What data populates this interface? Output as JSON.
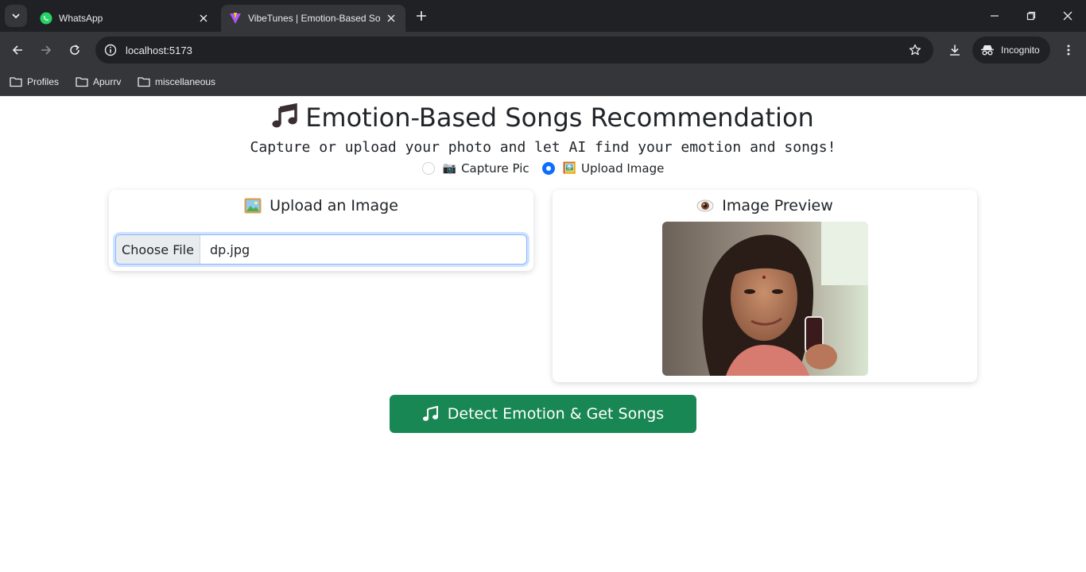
{
  "browser": {
    "tabs": [
      {
        "title": "WhatsApp",
        "icon": "whatsapp-icon"
      },
      {
        "title": "VibeTunes | Emotion-Based Song",
        "icon": "vite-icon"
      }
    ],
    "url": "localhost:5173",
    "incognito_label": "Incognito",
    "bookmarks": [
      "Profiles",
      "Apurrv",
      "miscellaneous"
    ]
  },
  "page": {
    "title": "Emotion-Based Songs Recommendation",
    "subtitle": "Capture or upload your photo and let AI find your emotion and songs!",
    "modes": [
      {
        "label": "Capture Pic",
        "emoji": "📷",
        "selected": false
      },
      {
        "label": "Upload Image",
        "emoji": "🖼️",
        "selected": true
      }
    ],
    "upload_card": {
      "heading": "Upload an Image",
      "choose_file_label": "Choose File",
      "file_name": "dp.jpg"
    },
    "preview_card": {
      "heading": "Image Preview"
    },
    "detect_button": "Detect Emotion & Get Songs"
  },
  "colors": {
    "accent_green": "#198754",
    "accent_blue": "#0d6efd"
  }
}
